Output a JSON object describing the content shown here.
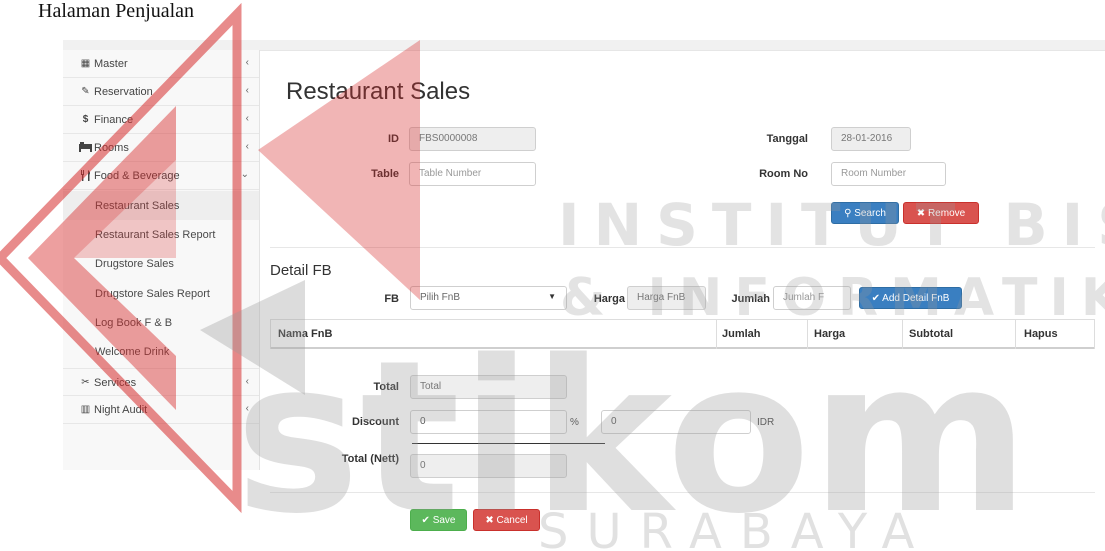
{
  "caption": "Halaman Penjualan",
  "sidebar": {
    "items": [
      {
        "label": "Master",
        "icon": "table-icon",
        "chevron": "‹"
      },
      {
        "label": "Reservation",
        "icon": "edit-icon",
        "chevron": "‹"
      },
      {
        "label": "Finance",
        "icon": "dollar-icon",
        "chevron": "‹"
      },
      {
        "label": "Rooms",
        "icon": "bed-icon",
        "chevron": "‹"
      },
      {
        "label": "Food & Beverage",
        "icon": "cutlery-icon",
        "chevron": "⌄"
      }
    ],
    "subitems": [
      {
        "label": "Restaurant Sales"
      },
      {
        "label": "Restaurant Sales Report"
      },
      {
        "label": "Drugstore Sales"
      },
      {
        "label": "Drugstore Sales Report"
      },
      {
        "label": "Log Book F & B"
      },
      {
        "label": "Welcome Drink"
      }
    ],
    "bottom_items": [
      {
        "label": "Services",
        "icon": "wrench-icon",
        "chevron": "‹"
      },
      {
        "label": "Night Audit",
        "icon": "book-icon",
        "chevron": "‹"
      }
    ]
  },
  "page": {
    "title": "Restaurant Sales",
    "form": {
      "id_label": "ID",
      "id_value": "FBS0000008",
      "table_label": "Table",
      "table_placeholder": "Table Number",
      "tanggal_label": "Tanggal",
      "tanggal_value": "28-01-2016",
      "room_label": "Room No",
      "room_placeholder": "Room Number",
      "search_label": "Search",
      "remove_label": "Remove"
    },
    "detail": {
      "title": "Detail FB",
      "fb_label": "FB",
      "fb_selected": "Pilih FnB",
      "harga_label": "Harga",
      "harga_placeholder": "Harga FnB",
      "jumlah_label": "Jumlah",
      "jumlah_placeholder": "Jumlah F",
      "add_label": "Add Detail FnB",
      "columns": [
        "Nama FnB",
        "Jumlah",
        "Harga",
        "Subtotal",
        "Hapus"
      ]
    },
    "totals": {
      "total_label": "Total",
      "total_placeholder": "Total",
      "discount_label": "Discount",
      "discount_percent": "0",
      "percent_symbol": "%",
      "discount_idr": "0",
      "idr_label": "IDR",
      "nett_label": "Total (Nett)",
      "nett_value": "0"
    },
    "actions": {
      "save_label": "Save",
      "cancel_label": "Cancel"
    }
  },
  "watermark": {
    "line1": "INSTITUT BISNIS",
    "line2": "& INFORMATIKA",
    "line3": "stikom",
    "line4": "SURABAYA",
    "color": "#d62b2b"
  }
}
